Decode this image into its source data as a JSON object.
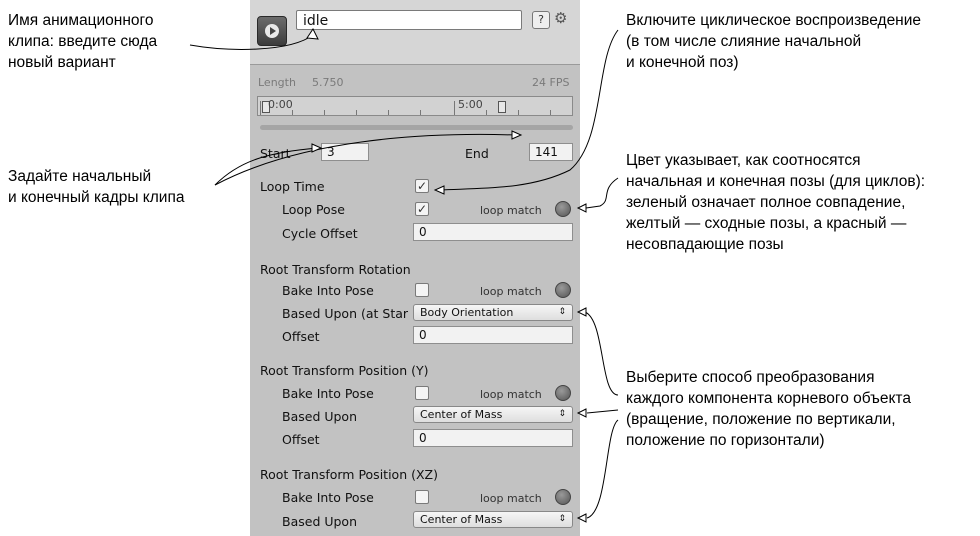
{
  "annotations": {
    "clip_name": [
      "Имя анимационного",
      "клипа: введите сюда",
      "новый вариант"
    ],
    "start_end": [
      "Задайте начальный",
      "и конечный кадры клипа"
    ],
    "loop_time": [
      "Включите циклическое воспроизведение",
      "(в том числе слияние начальной",
      "и конечной поз)"
    ],
    "loop_match": [
      "Цвет указывает, как соотносятся",
      "начальная и конечная позы (для циклов):",
      "зеленый означает полное совпадение,",
      "желтый — сходные позы, а красный —",
      "несовпадающие позы"
    ],
    "root_transform": [
      "Выберите способ преобразования",
      "каждого компонента корневого объекта",
      "(вращение, положение по вертикали,",
      "положение по горизонтали)"
    ]
  },
  "panel": {
    "clip_name_value": "idle",
    "help_icon": "?",
    "gear_icon": "⚙",
    "timeline": {
      "length_label": "Length",
      "length_value": "5.750",
      "fps": "24 FPS",
      "marker_start": "0:00",
      "marker_mid": "5:00"
    },
    "start_label": "Start",
    "start_value": "3",
    "end_label": "End",
    "end_value": "141",
    "loop_time": {
      "label": "Loop Time",
      "checked": "✓"
    },
    "loop_pose": {
      "label": "Loop Pose",
      "checked": "✓",
      "match_label": "loop match"
    },
    "cycle_offset": {
      "label": "Cycle Offset",
      "value": "0"
    },
    "rotation": {
      "heading": "Root Transform Rotation",
      "bake_label": "Bake Into Pose",
      "match_label": "loop match",
      "based_label": "Based Upon (at Star",
      "based_value": "Body Orientation",
      "offset_label": "Offset",
      "offset_value": "0"
    },
    "position_y": {
      "heading": "Root Transform Position (Y)",
      "bake_label": "Bake Into Pose",
      "match_label": "loop match",
      "based_label": "Based Upon",
      "based_value": "Center of Mass",
      "offset_label": "Offset",
      "offset_value": "0"
    },
    "position_xz": {
      "heading": "Root Transform Position (XZ)",
      "bake_label": "Bake Into Pose",
      "match_label": "loop match",
      "based_label": "Based Upon",
      "based_value": "Center of Mass"
    },
    "dropdown_arrow": "⇕"
  },
  "colors": {
    "panel_bg": "#c2c2c2",
    "header_bg": "#d6d6d6",
    "lamp": "#777777"
  }
}
